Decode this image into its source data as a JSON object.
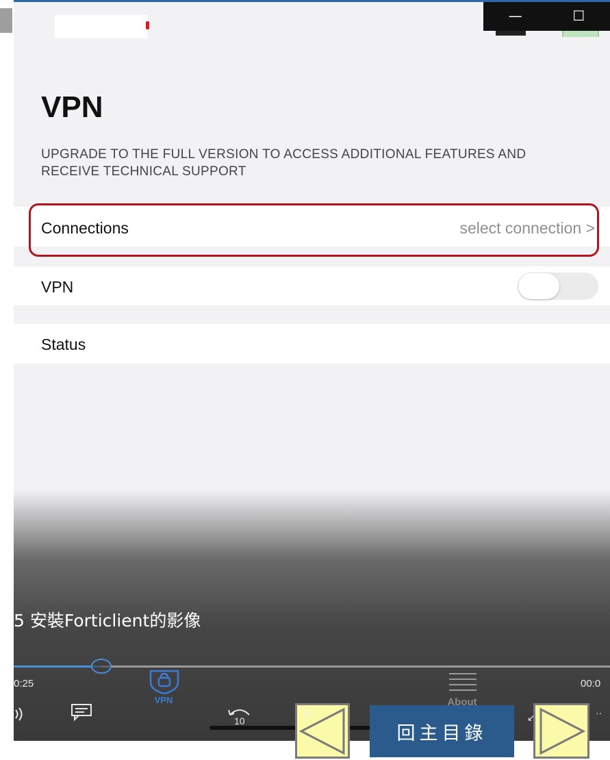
{
  "window": {
    "minimize_glyph": "—",
    "maximize_glyph": "☐"
  },
  "header": {
    "title": "VPN",
    "upgrade_notice": "UPGRADE TO THE FULL VERSION TO ACCESS ADDITIONAL FEATURES AND RECEIVE TECHNICAL SUPPORT"
  },
  "settings": {
    "connections_label": "Connections",
    "connections_value": "select connection",
    "chevron": ">",
    "vpn_label": "VPN",
    "vpn_enabled": false,
    "status_label": "Status"
  },
  "player": {
    "video_title": "5 安裝Forticlient的影像",
    "elapsed": "0:25",
    "remaining": "00:0",
    "tab_vpn_label": "VPN",
    "tab_about_label": "About",
    "rewind_label": "10"
  },
  "slide_nav": {
    "home_label": "回主目錄"
  },
  "colors": {
    "accent": "#3a7bd5",
    "highlight_border": "#b0141c",
    "nav_button_bg": "#fafaa8",
    "home_button_bg": "#2b5b8c"
  }
}
